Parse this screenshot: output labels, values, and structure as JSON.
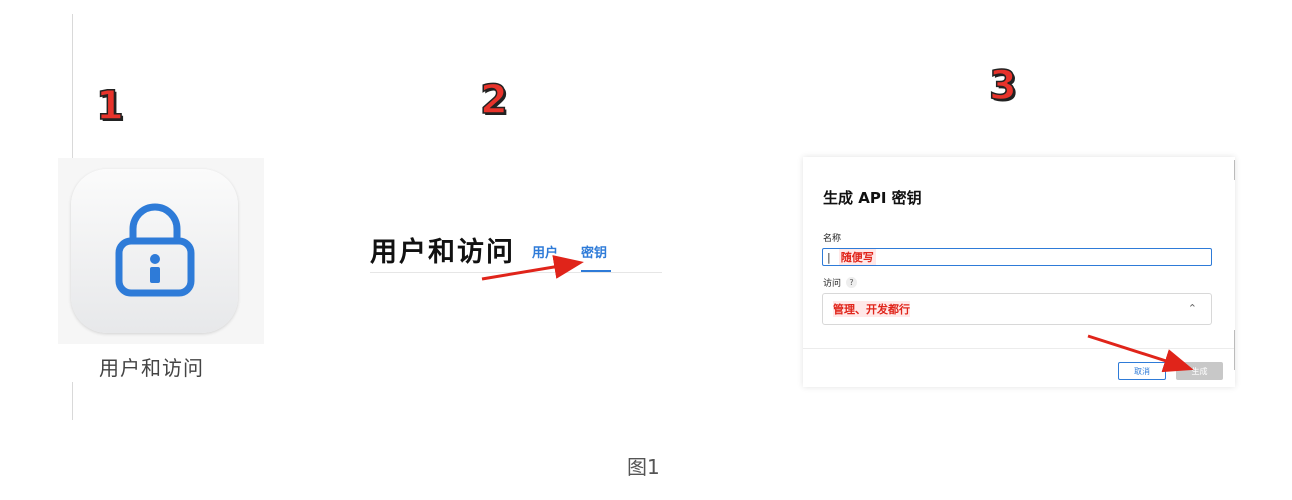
{
  "steps": [
    "1",
    "2",
    "3"
  ],
  "panel1": {
    "app_label": "用户和访问",
    "icon": "lock-icon"
  },
  "panel2": {
    "title": "用户和访问",
    "tabs": [
      "用户",
      "密钥"
    ],
    "active_tab": "密钥"
  },
  "panel3": {
    "dialog_title": "生成 API 密钥",
    "name_label": "名称",
    "name_value": "随便写",
    "access_label": "访问",
    "access_help": "?",
    "access_value": "管理、开发都行",
    "cancel_label": "取消",
    "generate_label": "生成"
  },
  "caption": "图1",
  "colors": {
    "accent": "#2e7bd8",
    "annotation_red": "#e0241a",
    "step_red": "#e8332b"
  }
}
